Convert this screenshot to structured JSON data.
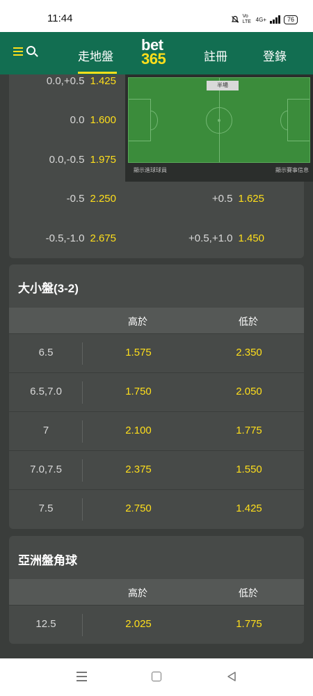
{
  "status_bar": {
    "time": "11:44",
    "network": "4G+",
    "volte": "Vo LTE",
    "battery": "76"
  },
  "header": {
    "nav_live": "走地盤",
    "logo_top": "bet",
    "logo_bottom": "365",
    "nav_register": "註冊",
    "nav_login": "登錄",
    "colors": {
      "header_bg": "#126e51",
      "accent": "#ffdf1b"
    }
  },
  "pitch": {
    "period": "半場",
    "link_left": "顯示進球球員",
    "link_right": "顯示賽事信息"
  },
  "handicap": {
    "left": [
      {
        "line": "0.0,+0.5",
        "odds": "1.425"
      },
      {
        "line": "0.0",
        "odds": "1.600"
      },
      {
        "line": "0.0,-0.5",
        "odds": "1.975"
      },
      {
        "line": "-0.5",
        "odds": "2.250"
      },
      {
        "line": "-0.5,-1.0",
        "odds": "2.675"
      }
    ],
    "right": [
      {
        "line": "+0.5",
        "odds": "1.625"
      },
      {
        "line": "+0.5,+1.0",
        "odds": "1.450"
      }
    ]
  },
  "over_under": {
    "title": "大小盤(3-2)",
    "col_over": "高於",
    "col_under": "低於",
    "rows": [
      {
        "line": "6.5",
        "over": "1.575",
        "under": "2.350"
      },
      {
        "line": "6.5,7.0",
        "over": "1.750",
        "under": "2.050"
      },
      {
        "line": "7",
        "over": "2.100",
        "under": "1.775"
      },
      {
        "line": "7.0,7.5",
        "over": "2.375",
        "under": "1.550"
      },
      {
        "line": "7.5",
        "over": "2.750",
        "under": "1.425"
      }
    ]
  },
  "asian_corners": {
    "title": "亞洲盤角球",
    "col_over": "高於",
    "col_under": "低於",
    "rows": [
      {
        "line": "12.5",
        "over": "2.025",
        "under": "1.775"
      }
    ]
  }
}
